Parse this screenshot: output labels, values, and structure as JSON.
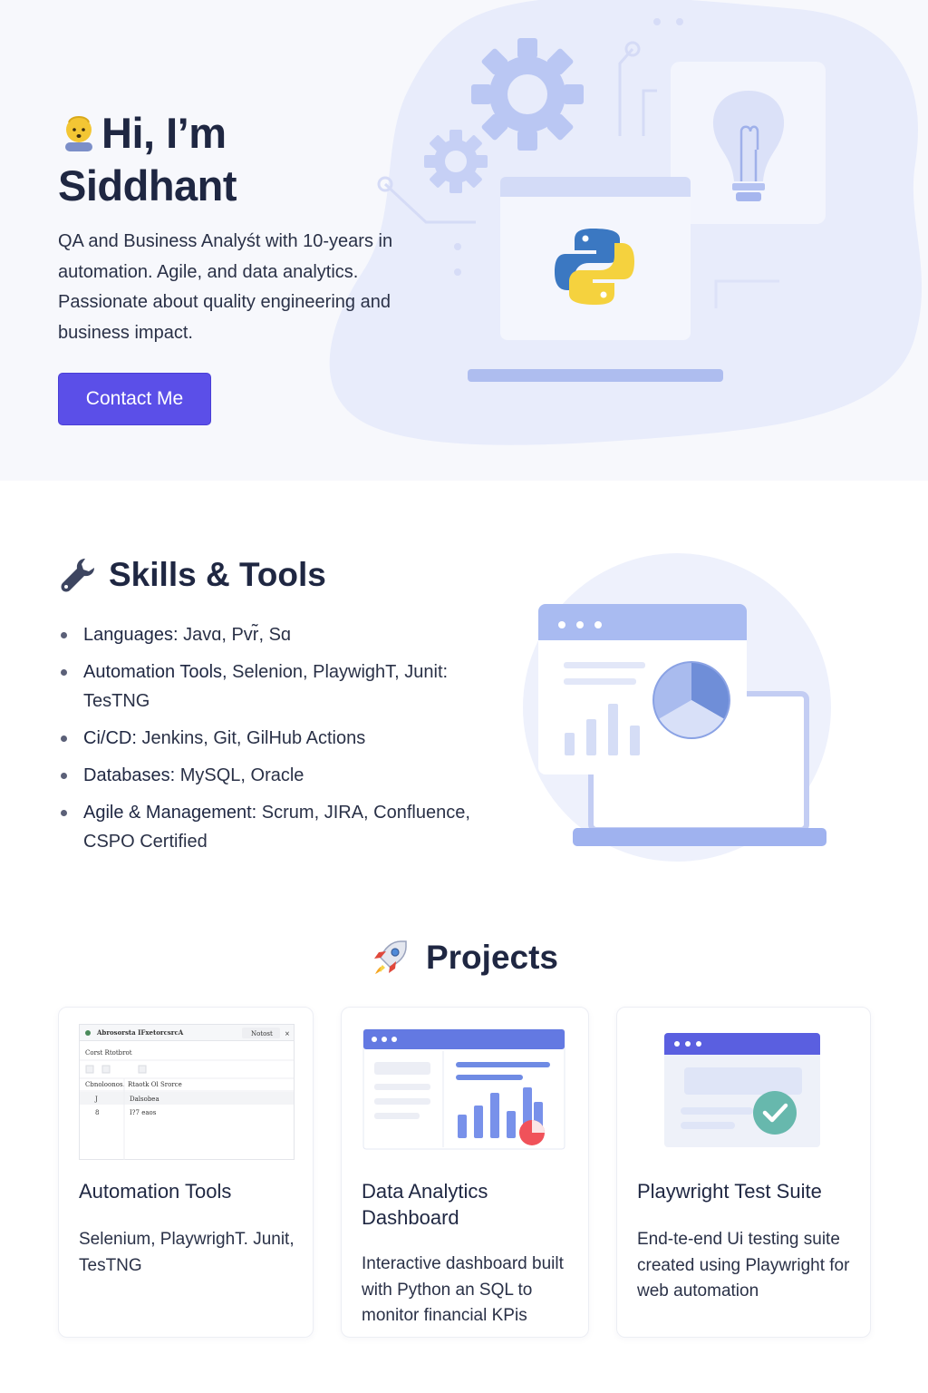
{
  "hero": {
    "greeting": "Hi, I’m",
    "name": "Siddhant",
    "description": "QA and Business Analyśt with 10-years in automation. Agile, and data analytics. Passionate about quality engineering and business impact.",
    "contact_button": "Contact Me",
    "accent_color": "#5b4fe8"
  },
  "skills": {
    "title": "Skills & Tools",
    "items": [
      {
        "key": "Languages:",
        "value": " Javɑ, Pvr̃, Sɑ"
      },
      {
        "key": "Automation Tools,",
        "value": " Selenion, PlaywighT, Junit: TesTNG"
      },
      {
        "key": "Ci/CD:",
        "value": " Jenkins, Git, GilHub Actions"
      },
      {
        "key": "Databases:",
        "value": " MySQL, Oracle"
      },
      {
        "key": "Agile & Management:",
        "value": " Scrum, JIRA, Confluence, CSPO Certified"
      }
    ]
  },
  "projects": {
    "title": "Projects",
    "cards": [
      {
        "title": "Automation Tools",
        "description": "Selenium, PlaywrighT. Junit, TesTNG",
        "thumb": {
          "window_title": "Abrosorsta IFxetorcsrcA",
          "button": "Notost",
          "close": "×",
          "toolbar_label": "Corst Rtotbrot",
          "col1": "Cbnoloonos.",
          "col2": "Rtaotk Ol Srorce",
          "row1_num": "J",
          "row1_text": "Dalsobea",
          "row2_num": "8",
          "row2_text": "I?7 eaos"
        }
      },
      {
        "title": "Data Analytics Dashboard",
        "description": "Interactive dashboard built with Python an SQL to monitor financial KPis"
      },
      {
        "title": "Playwright Test Suite",
        "description": "End-te-end Ui testing suite created using Playwright for web automation"
      }
    ]
  },
  "icons": {
    "greeting": "waving-person-icon",
    "skills": "wrench-icon",
    "projects": "rocket-icon",
    "hero_illustration": "python-laptop-illustration",
    "skills_illustration": "dashboard-laptop-illustration"
  }
}
